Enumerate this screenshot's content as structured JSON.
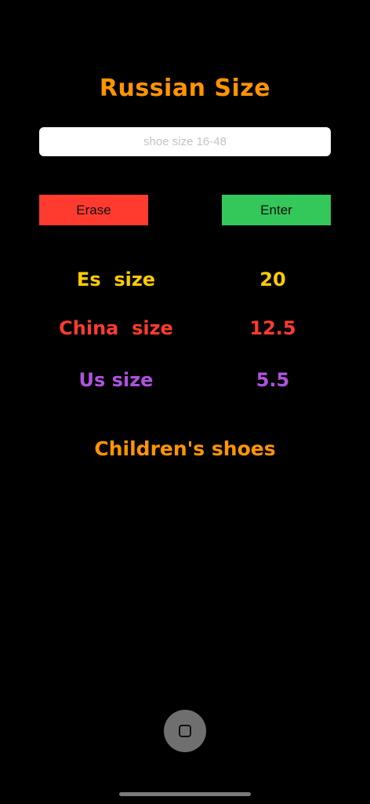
{
  "title": "Russian Size",
  "input": {
    "placeholder": "shoe size 16-48",
    "value": ""
  },
  "buttons": {
    "erase_label": "Erase",
    "enter_label": "Enter"
  },
  "results": [
    {
      "label": "Es  size",
      "value": "20"
    },
    {
      "label": "China  size",
      "value": "12.5"
    },
    {
      "label": "Us size",
      "value": "5.5"
    }
  ],
  "category": "Children's shoes",
  "colors": {
    "background": "#000000",
    "title": "#FF9500",
    "es": "#FFCC00",
    "china": "#FF3B30",
    "us": "#AF52DE",
    "category": "#FF9500",
    "erase_button": "#FF3B30",
    "enter_button": "#34C759",
    "input_background": "#FFFFFF"
  },
  "icons": {
    "home_button": "square-icon"
  }
}
